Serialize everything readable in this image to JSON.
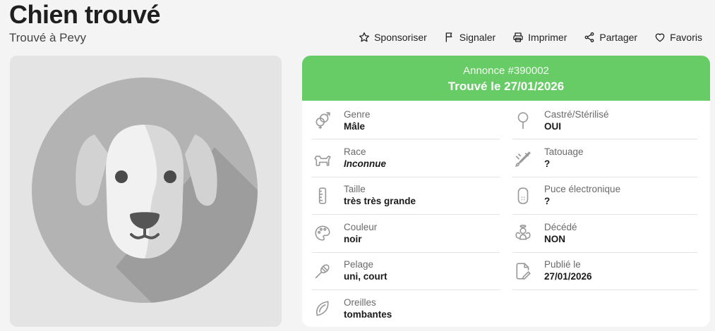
{
  "header": {
    "title": "Chien trouvé",
    "subtitle": "Trouvé à Pevy"
  },
  "actions": [
    {
      "label": "Sponsoriser",
      "icon": "star-icon"
    },
    {
      "label": "Signaler",
      "icon": "flag-icon"
    },
    {
      "label": "Imprimer",
      "icon": "printer-icon"
    },
    {
      "label": "Partager",
      "icon": "share-icon"
    },
    {
      "label": "Favoris",
      "icon": "heart-icon"
    }
  ],
  "listing": {
    "annonce": "Annonce #390002",
    "status": "Trouvé le 27/01/2026",
    "accent_color": "#67cc65"
  },
  "details": {
    "left": [
      {
        "label": "Genre",
        "value": "Mâle",
        "icon": "gender-icon"
      },
      {
        "label": "Race",
        "value": "Inconnue",
        "icon": "dog-icon"
      },
      {
        "label": "Taille",
        "value": "très très grande",
        "icon": "ruler-icon"
      },
      {
        "label": "Couleur",
        "value": "noir",
        "icon": "palette-icon"
      },
      {
        "label": "Pelage",
        "value": "uni, court",
        "icon": "brush-icon"
      },
      {
        "label": "Oreilles",
        "value": "tombantes",
        "icon": "ear-icon"
      }
    ],
    "right": [
      {
        "label": "Castré/Stérilisé",
        "value": "OUI",
        "icon": "sterilized-icon"
      },
      {
        "label": "Tatouage",
        "value": "?",
        "icon": "tattoo-icon"
      },
      {
        "label": "Puce électronique",
        "value": "?",
        "icon": "chip-icon"
      },
      {
        "label": "Décédé",
        "value": "NON",
        "icon": "angel-icon"
      },
      {
        "label": "Publié le",
        "value": "27/01/2026",
        "icon": "publish-icon"
      }
    ]
  }
}
